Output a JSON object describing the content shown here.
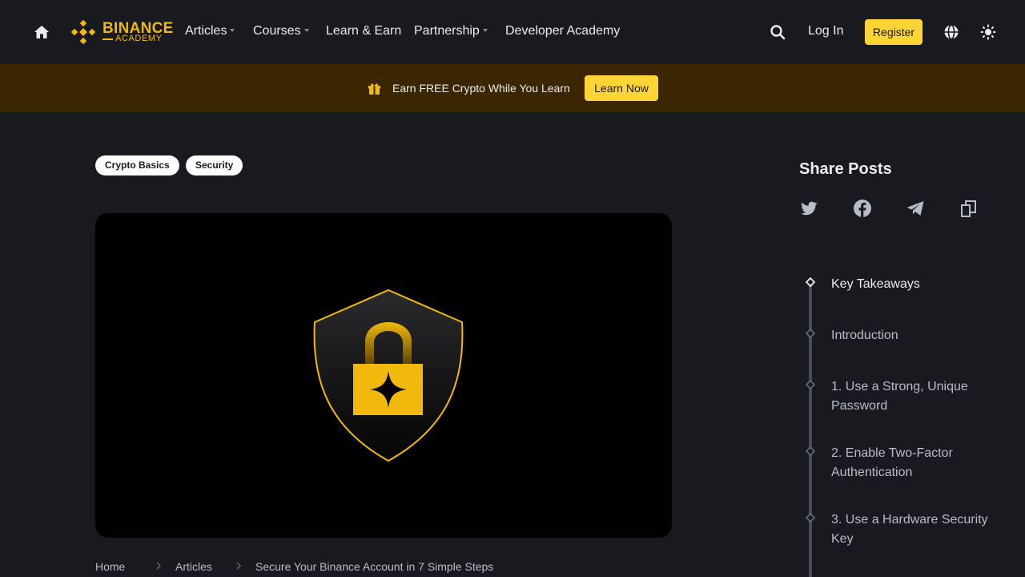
{
  "nav": {
    "logo_line1": "BINANCE",
    "logo_line2": "ACADEMY",
    "links": [
      {
        "label": "Articles",
        "dropdown": true
      },
      {
        "label": "Courses",
        "dropdown": true
      },
      {
        "label": "Learn & Earn",
        "dropdown": false
      },
      {
        "label": "Partnership",
        "dropdown": true
      },
      {
        "label": "Developer Academy",
        "dropdown": false
      }
    ],
    "login_label": "Log In",
    "register_label": "Register"
  },
  "promo": {
    "text": "Earn FREE Crypto While You Learn",
    "button_label": "Learn Now"
  },
  "tags": [
    "Crypto Basics",
    "Security"
  ],
  "hero": {
    "icon": "shield-lock-icon"
  },
  "breadcrumb": [
    "Home",
    "Articles",
    "Secure Your Binance Account in 7 Simple Steps"
  ],
  "share": {
    "title": "Share Posts",
    "icons": [
      "twitter-icon",
      "facebook-icon",
      "telegram-icon",
      "copy-link-icon"
    ]
  },
  "toc": [
    {
      "label": "Key Takeaways",
      "active": true
    },
    {
      "label": "Introduction",
      "active": false
    },
    {
      "label": "1. Use a Strong, Unique Password",
      "active": false
    },
    {
      "label": "2. Enable Two-Factor Authentication",
      "active": false
    },
    {
      "label": "3. Use a Hardware Security Key",
      "active": false
    }
  ],
  "colors": {
    "accent": "#fcd535",
    "brand": "#f0b90b",
    "background": "#181a20",
    "promo_bg": "#3c2601"
  }
}
